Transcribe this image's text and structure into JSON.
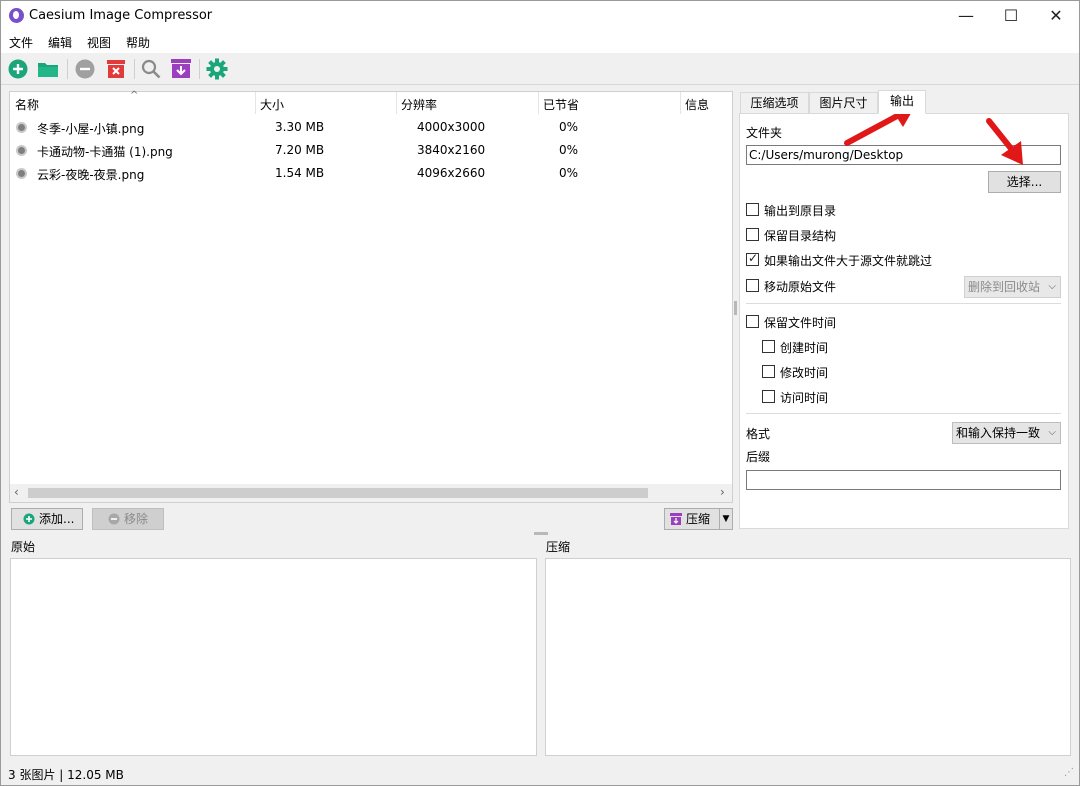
{
  "window": {
    "title": "Caesium Image Compressor",
    "minimize": "—",
    "maximize": "☐",
    "close": "✕"
  },
  "menu": [
    "文件",
    "编辑",
    "视图",
    "帮助"
  ],
  "toolbar_icons": [
    "add-icon",
    "open-folder-icon",
    "remove-icon",
    "clear-list-icon",
    "preview-icon",
    "compress-icon",
    "settings-icon"
  ],
  "colors": {
    "accent_green": "#1aa57a",
    "accent_purple": "#9b3fbf",
    "accent_red": "#e03a3a",
    "arrow_red": "#e01818"
  },
  "file_list": {
    "columns": [
      "名称",
      "大小",
      "分辨率",
      "已节省",
      "信息"
    ],
    "rows": [
      {
        "name": "冬季-小屋-小镇.png",
        "size": "3.30 MB",
        "resolution": "4000x3000",
        "saved": "0%"
      },
      {
        "name": "卡通动物-卡通猫 (1).png",
        "size": "7.20 MB",
        "resolution": "3840x2160",
        "saved": "0%"
      },
      {
        "name": "云彩-夜晚-夜景.png",
        "size": "1.54 MB",
        "resolution": "4096x2660",
        "saved": "0%"
      }
    ]
  },
  "buttons": {
    "add": "添加...",
    "remove": "移除",
    "compress": "压缩"
  },
  "tabs": [
    "压缩选项",
    "图片尺寸",
    "输出"
  ],
  "output": {
    "folder_label": "文件夹",
    "folder_value": "C:/Users/murong/Desktop",
    "choose": "选择...",
    "options": [
      {
        "label": "输出到原目录",
        "checked": false
      },
      {
        "label": "保留目录结构",
        "checked": false
      },
      {
        "label": "如果输出文件大于源文件就跳过",
        "checked": true
      },
      {
        "label": "移动原始文件",
        "checked": false
      }
    ],
    "move_target": "删除到回收站",
    "keep_dates": {
      "label": "保留文件时间",
      "checked": false
    },
    "dates": [
      {
        "label": "创建时间",
        "checked": false
      },
      {
        "label": "修改时间",
        "checked": false
      },
      {
        "label": "访问时间",
        "checked": false
      }
    ],
    "format_label": "格式",
    "format_value": "和输入保持一致",
    "suffix_label": "后缀",
    "suffix_value": ""
  },
  "preview": {
    "original": "原始",
    "compressed": "压缩"
  },
  "status": "3 张图片 | 12.05 MB"
}
